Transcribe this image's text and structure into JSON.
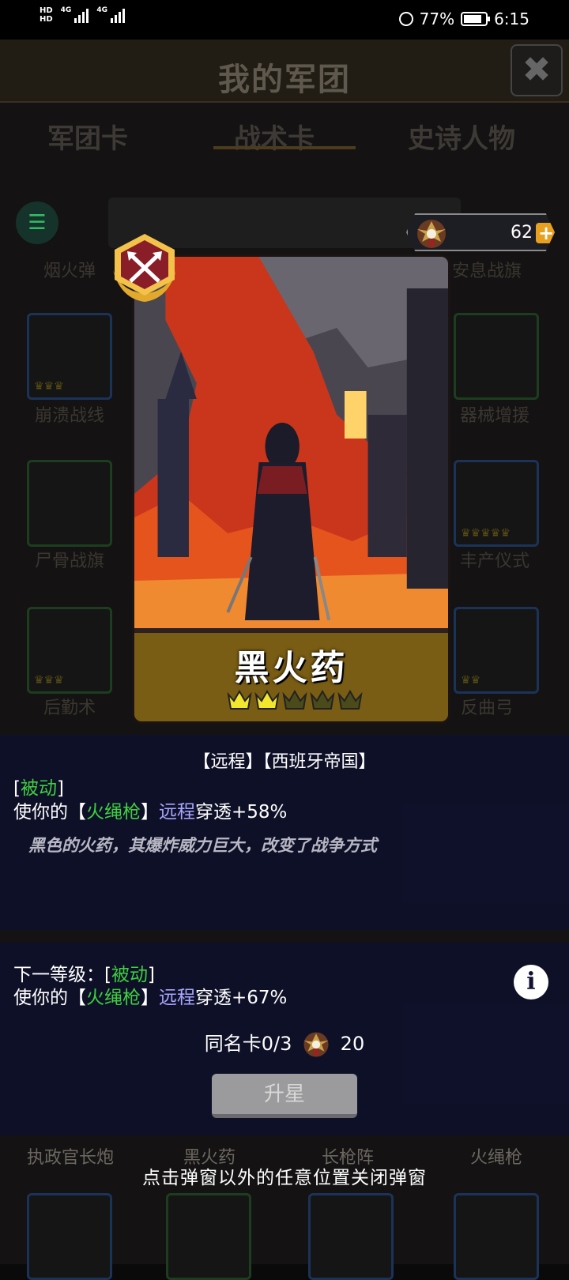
{
  "status": {
    "left_badges": [
      "HD",
      "HD"
    ],
    "net1": "4G",
    "net2": "4G",
    "battery_pct": "77%",
    "time": "6:15"
  },
  "background": {
    "title": "我的军团",
    "tabs": [
      "军团卡",
      "战术卡",
      "史诗人物"
    ],
    "grid_labels": [
      "烟火弹",
      "安息战旗",
      "崩溃战线",
      "器械增援",
      "尸骨战旗",
      "丰产仪式",
      "后勤术",
      "反曲弓"
    ],
    "bottom_labels": [
      "执政官长炮",
      "黑火药",
      "长枪阵",
      "火绳枪"
    ]
  },
  "currency": {
    "value": "62",
    "plus": "+"
  },
  "card": {
    "name": "黑火药",
    "stars_filled": 2,
    "stars_total": 5,
    "icon": "crossed-arrows-badge-icon"
  },
  "detail": {
    "tags": "【远程】【西班牙帝国】",
    "type_open": "[",
    "type": "被动",
    "type_close": "]",
    "effect_prefix": "使你的【",
    "effect_target": "火绳枪",
    "effect_mid": "】",
    "effect_stat": "远程",
    "effect_suffix": "穿透+58%",
    "flavor": "黑色的火药，其爆炸威力巨大，改变了战争方式"
  },
  "next_level": {
    "label": "下一等级：[",
    "type": "被动",
    "type_close": "]",
    "effect_prefix": "使你的【",
    "effect_target": "火绳枪",
    "effect_mid": "】",
    "effect_stat": "远程",
    "effect_suffix": "穿透+67%",
    "info_icon": "i"
  },
  "upgrade": {
    "same_name": "同名卡0/3",
    "cost": "20",
    "button": "升星"
  },
  "hint": "点击弹窗以外的任意位置关闭弹窗",
  "colors": {
    "passive_green": "#3fcf3f",
    "stat_blue": "#a9a7ff",
    "panel_bg": "#0e112a",
    "card_gold": "#7a5d14",
    "crown_yellow": "#f2e72c"
  }
}
